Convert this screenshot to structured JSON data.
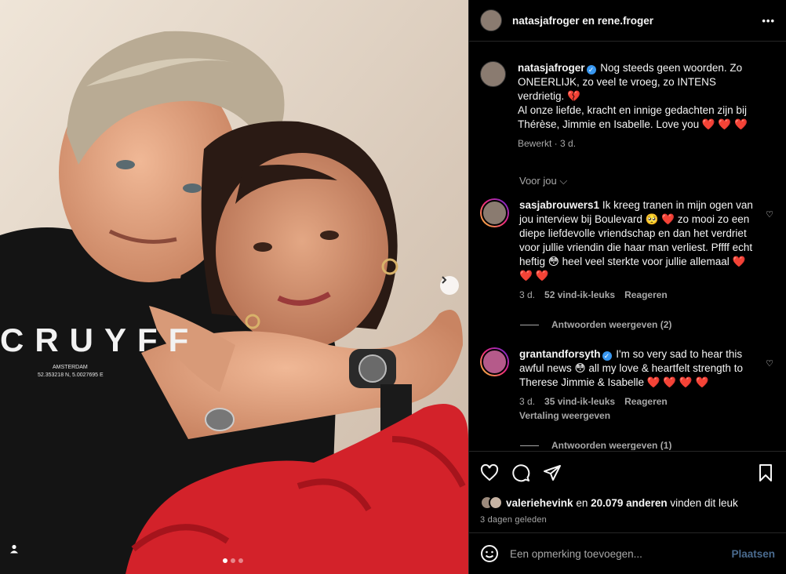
{
  "header": {
    "title": "natasjafroger en rene.froger",
    "more_label": "•••"
  },
  "photo": {
    "shirt_brand": "CRUYFF",
    "shirt_sub1": "AMSTERDAM",
    "shirt_sub2": "52.353218 N, 5.0027695 E",
    "carousel_slide": 1,
    "carousel_total": 3
  },
  "caption": {
    "username": "natasjafroger",
    "text": "Nog steeds geen woorden. Zo ONEERLIJK, zo veel te vroeg, zo INTENS verdrietig. 💔\nAl onze liefde, kracht en innige gedachten zijn bij Thérèse, Jimmie en Isabelle. Love you ❤️ ❤️ ❤️",
    "meta": "Bewerkt · 3 d."
  },
  "sort": {
    "label": "Voor jou"
  },
  "comments": [
    {
      "username": "sasjabrouwers1",
      "verified": false,
      "text": "Ik kreeg tranen in mijn ogen van jou interview bij Boulevard 🥺 ❤️  zo mooi zo een diepe liefdevolle vriendschap en dan het verdriet voor jullie vriendin die haar man verliest. Pffff echt heftig 😳  heel veel sterkte voor jullie allemaal ❤️ ❤️ ❤️",
      "time": "3 d.",
      "likes": "52 vind-ik-leuks",
      "reply": "Reageren",
      "translate": "",
      "view_replies": "Antwoorden weergeven (2)"
    },
    {
      "username": "grantandforsyth",
      "verified": true,
      "text": "I'm so very sad to hear this awful news 😳  all my love & heartfelt strength to Therese Jimmie & Isabelle ❤️ ❤️ ❤️ ❤️",
      "time": "3 d.",
      "likes": "35 vind-ik-leuks",
      "reply": "Reageren",
      "translate": "Vertaling weergeven",
      "view_replies": "Antwoorden weergeven (1)"
    }
  ],
  "likes": {
    "text_user": "valeriehevink",
    "text_rest": " en ",
    "count_text": "20.079 anderen",
    "suffix": " vinden dit leuk"
  },
  "date": "3 dagen geleden",
  "add_comment": {
    "placeholder": "Een opmerking toevoegen...",
    "post_label": "Plaatsen"
  },
  "icons": {
    "like": "heart-icon",
    "comment": "comment-icon",
    "share": "share-icon",
    "save": "bookmark-icon",
    "next": "chevron-right-icon",
    "tag": "user-tag-icon",
    "emoji": "emoji-icon"
  },
  "colors": {
    "accent_blue": "#3897f0",
    "post_disabled": "#4a6b8f",
    "dress_red": "#d3222a"
  }
}
